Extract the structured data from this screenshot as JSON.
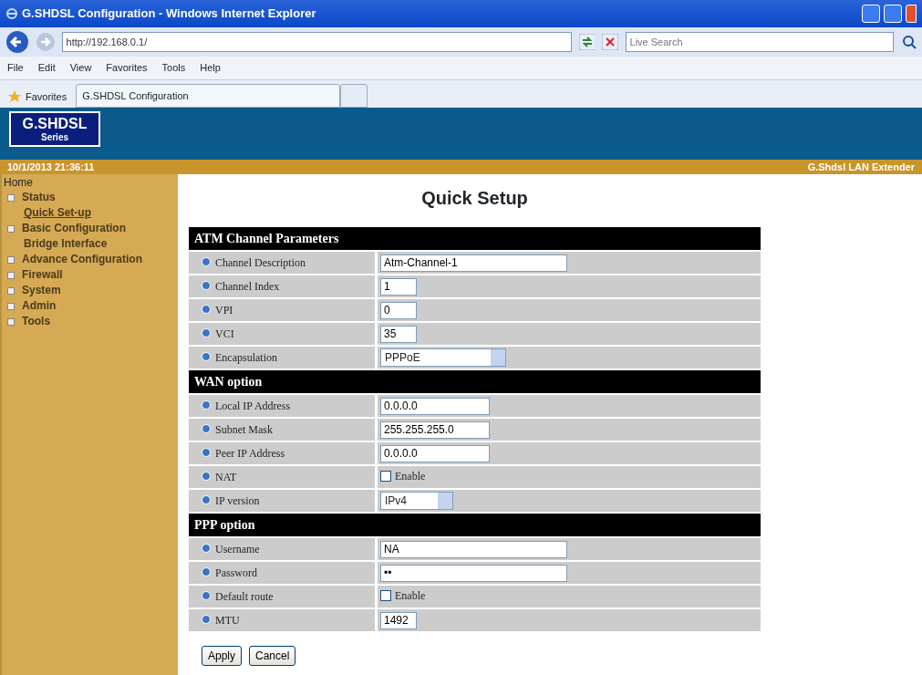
{
  "window": {
    "title": "G.SHDSL Configuration - Windows Internet Explorer"
  },
  "address_bar": {
    "url": "http://192.168.0.1/"
  },
  "search": {
    "placeholder": "Live Search"
  },
  "menu": [
    "File",
    "Edit",
    "View",
    "Favorites",
    "Tools",
    "Help"
  ],
  "favorites_bar": {
    "label": "Favorites",
    "tab": "G.SHDSL Configuration"
  },
  "banner": {
    "logo_title": "G.SHDSL",
    "logo_subtitle": "Series"
  },
  "status_strip": {
    "datetime": "10/1/2013 21:36:11",
    "product": "G.Shdsl LAN Extender"
  },
  "sidebar": {
    "root": "Home",
    "items": [
      {
        "label": "Status",
        "expandable": true,
        "selected": false
      },
      {
        "label": "Quick Set-up",
        "expandable": false,
        "selected": true
      },
      {
        "label": "Basic Configuration",
        "expandable": true,
        "selected": false
      },
      {
        "label": "Bridge Interface",
        "expandable": false,
        "selected": false
      },
      {
        "label": "Advance Configuration",
        "expandable": true,
        "selected": false
      },
      {
        "label": "Firewall",
        "expandable": true,
        "selected": false
      },
      {
        "label": "System",
        "expandable": true,
        "selected": false
      },
      {
        "label": "Admin",
        "expandable": true,
        "selected": false
      },
      {
        "label": "Tools",
        "expandable": true,
        "selected": false
      }
    ]
  },
  "page_title": "Quick Setup",
  "sections": [
    {
      "title": "ATM Channel Parameters",
      "rows": [
        {
          "label": "Channel Description",
          "kind": "text",
          "value": "Atm-Channel-1"
        },
        {
          "label": "Channel Index",
          "kind": "text",
          "value": "1"
        },
        {
          "label": "VPI",
          "kind": "text",
          "value": "0"
        },
        {
          "label": "VCI",
          "kind": "text",
          "value": "35"
        },
        {
          "label": "Encapsulation",
          "kind": "select",
          "value": "PPPoE"
        }
      ]
    },
    {
      "title": "WAN option",
      "rows": [
        {
          "label": "Local IP Address",
          "kind": "text",
          "value": "0.0.0.0"
        },
        {
          "label": "Subnet Mask",
          "kind": "text",
          "value": "255.255.255.0"
        },
        {
          "label": "Peer IP Address",
          "kind": "text",
          "value": "0.0.0.0"
        },
        {
          "label": "NAT",
          "kind": "checkbox",
          "checked": false,
          "text": "Enable"
        },
        {
          "label": "IP version",
          "kind": "select",
          "value": "IPv4"
        }
      ]
    },
    {
      "title": "PPP option",
      "rows": [
        {
          "label": "Username",
          "kind": "text",
          "value": "NA"
        },
        {
          "label": "Password",
          "kind": "text",
          "value": "••"
        },
        {
          "label": "Default route",
          "kind": "checkbox",
          "checked": false,
          "text": "Enable"
        },
        {
          "label": "MTU",
          "kind": "text",
          "value": "1492"
        }
      ]
    }
  ],
  "buttons": [
    "Apply",
    "Cancel"
  ]
}
